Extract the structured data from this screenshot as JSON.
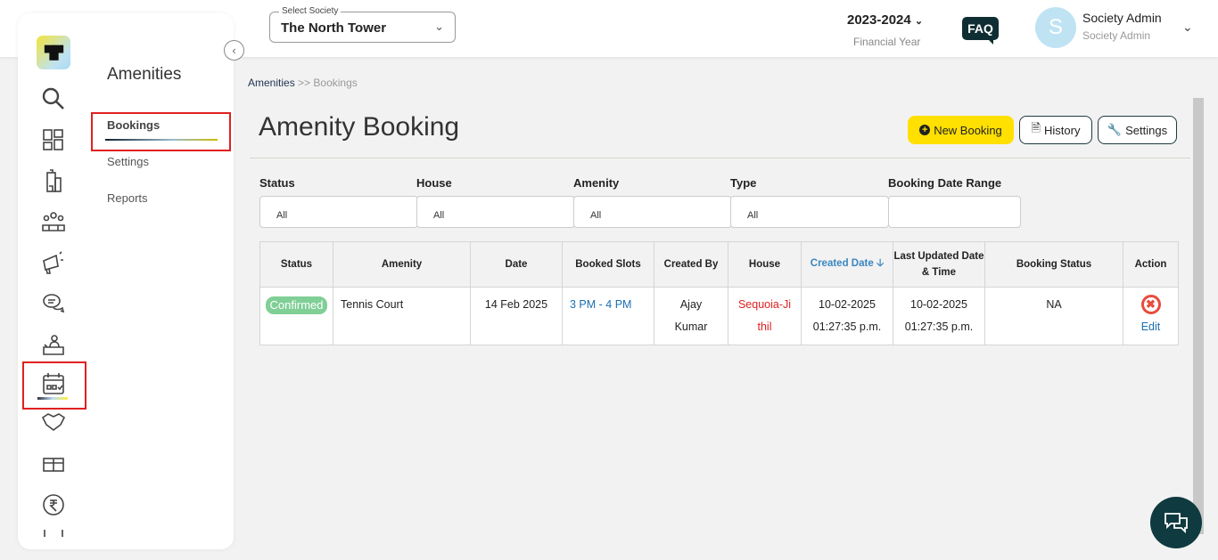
{
  "header": {
    "society_label": "Select Society",
    "society_value": "The North Tower",
    "financial_year": "2023-2024",
    "financial_year_label": "Financial Year",
    "faq": "FAQ",
    "avatar_initial": "S",
    "user_name": "Society Admin",
    "user_role": "Society Admin"
  },
  "sidebar": {
    "logo_text": "iTOr",
    "section_title": "Amenities",
    "items": [
      {
        "label": "Bookings"
      },
      {
        "label": "Settings"
      },
      {
        "label": "Reports"
      }
    ]
  },
  "breadcrumb": {
    "parent": "Amenities",
    "separator": ">>",
    "current": "Bookings"
  },
  "page": {
    "title": "Amenity Booking",
    "new_booking": "New Booking",
    "history": "History",
    "settings": "Settings"
  },
  "filters": [
    {
      "label": "Status",
      "value": "All"
    },
    {
      "label": "House",
      "value": "All"
    },
    {
      "label": "Amenity",
      "value": "All"
    },
    {
      "label": "Type",
      "value": "All"
    },
    {
      "label": "Booking Date Range",
      "value": ""
    }
  ],
  "table": {
    "headers": [
      "Status",
      "Amenity",
      "Date",
      "Booked Slots",
      "Created By",
      "House",
      "Created Date",
      "Last Updated Date & Time",
      "Booking Status",
      "Action"
    ],
    "rows": [
      {
        "status": "Confirmed",
        "amenity": "Tennis Court",
        "date": "14 Feb 2025",
        "slots": "3 PM - 4 PM",
        "created_by": "Ajay Kumar",
        "house": "Sequoia-Jithil",
        "created_date": "10-02-2025",
        "created_time": "01:27:35 p.m.",
        "updated_date": "10-02-2025",
        "updated_time": "01:27:35 p.m.",
        "booking_status": "NA",
        "edit": "Edit"
      }
    ]
  },
  "colors": {
    "accent": "#ffe000",
    "link": "#1a6fb0",
    "house": "#e02020",
    "badge": "#7fcf96",
    "dark": "#0f3a3f"
  }
}
